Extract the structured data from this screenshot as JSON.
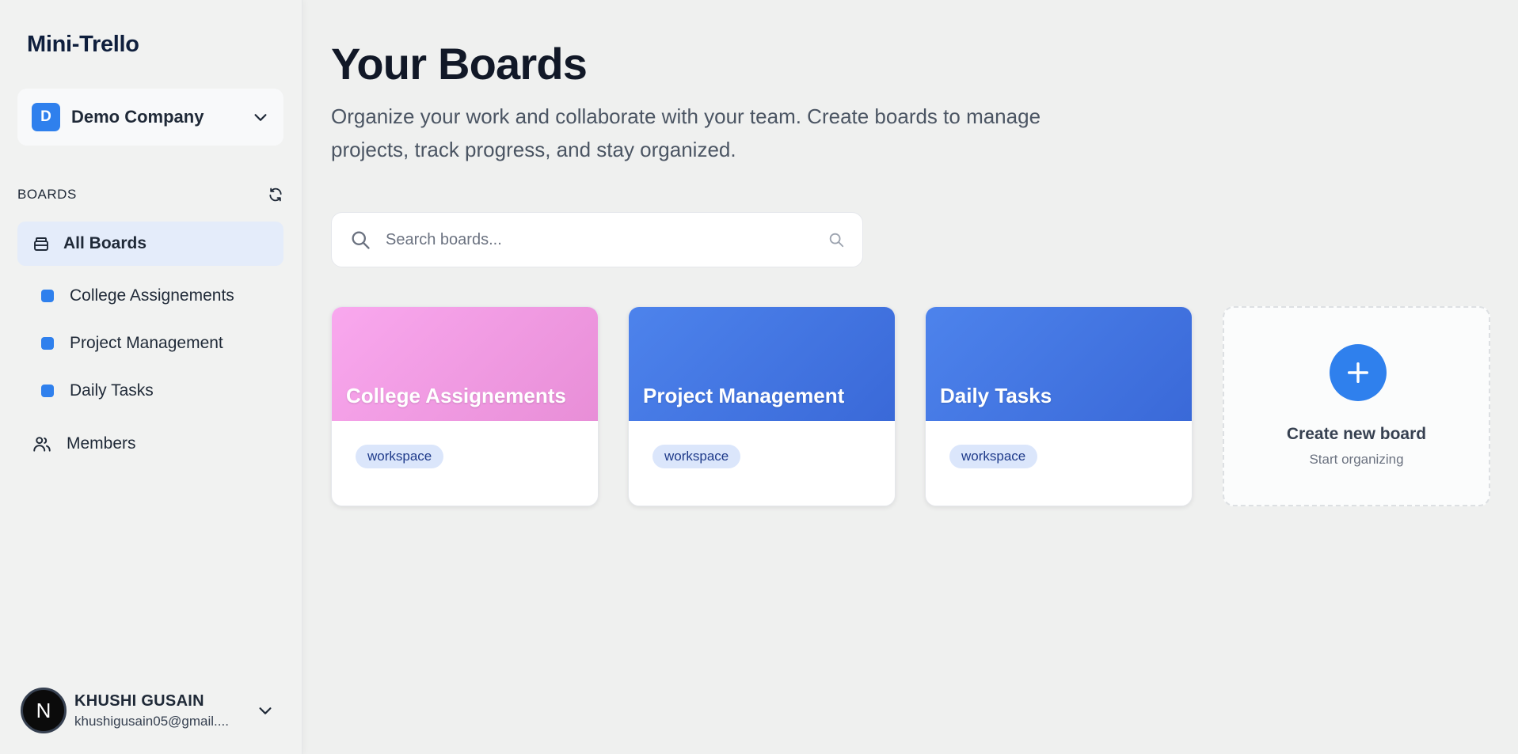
{
  "app": {
    "title": "Mini-Trello"
  },
  "workspace": {
    "badge": "D",
    "name": "Demo Company",
    "accent": "#2f80ed"
  },
  "sidebar": {
    "section_label": "BOARDS",
    "all_boards_label": "All Boards",
    "boards": [
      {
        "label": "College Assignements",
        "color": "#2f80ed"
      },
      {
        "label": "Project Management",
        "color": "#2f80ed"
      },
      {
        "label": "Daily Tasks",
        "color": "#2f80ed"
      }
    ],
    "members_label": "Members"
  },
  "user": {
    "avatar_letter": "N",
    "name": "KHUSHI GUSAIN",
    "email": "khushigusain05@gmail...."
  },
  "main": {
    "title": "Your Boards",
    "subtitle": "Organize your work and collaborate with your team. Create boards to manage projects, track progress, and stay organized.",
    "search": {
      "placeholder": "Search boards...",
      "value": ""
    },
    "cards": [
      {
        "title": "College Assignements",
        "tag": "workspace",
        "gradient_from": "#f9a8ee",
        "gradient_to": "#e88ed7"
      },
      {
        "title": "Project Management",
        "tag": "workspace",
        "gradient_from": "#4d83ec",
        "gradient_to": "#3a69d8"
      },
      {
        "title": "Daily Tasks",
        "tag": "workspace",
        "gradient_from": "#4d83ec",
        "gradient_to": "#3a69d8"
      }
    ],
    "create": {
      "title": "Create new board",
      "subtitle": "Start organizing"
    }
  },
  "icons": {
    "workspace_chevron": "chevron-down-icon",
    "refresh": "refresh-icon",
    "all_boards": "archive-box-icon",
    "members": "users-icon",
    "search": "search-icon",
    "plus": "plus-icon",
    "user_menu": "chevron-down-icon"
  }
}
